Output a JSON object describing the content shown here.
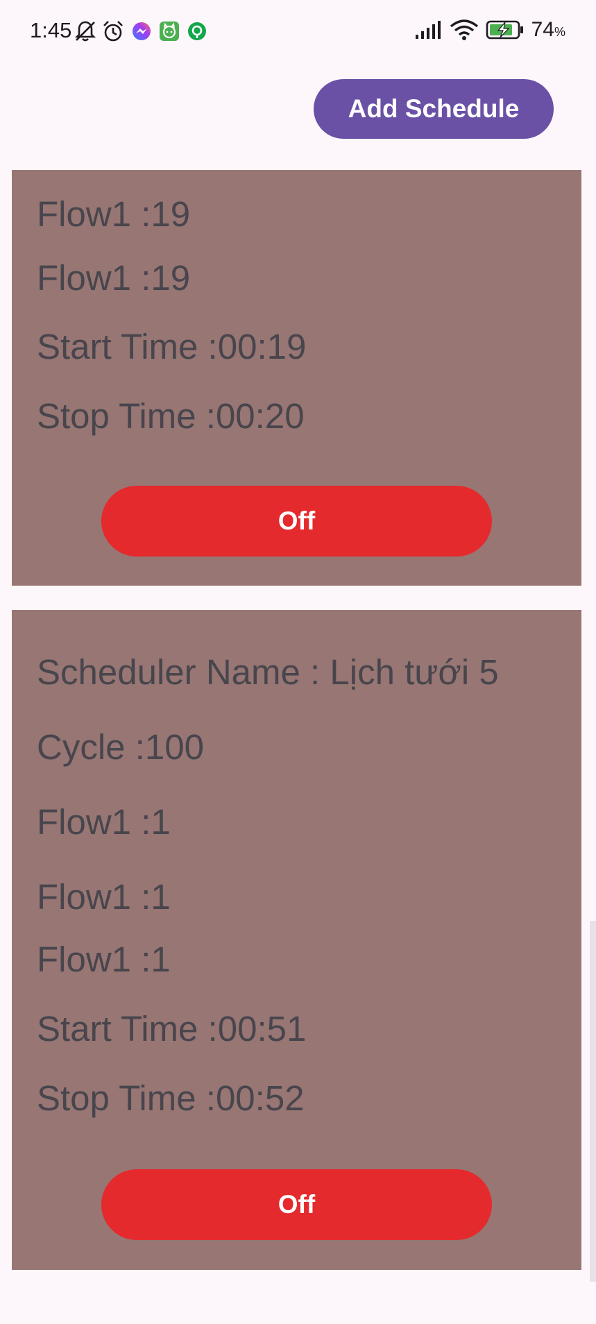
{
  "status_bar": {
    "time": "1:45",
    "battery_percent": "74",
    "battery_unit": "%"
  },
  "toolbar": {
    "add_schedule_label": "Add Schedule"
  },
  "cards": [
    {
      "fields": [
        "Flow1 :19",
        "Flow1 :19",
        "Start Time :00:19",
        "Stop Time :00:20"
      ],
      "button_label": "Off"
    },
    {
      "fields": [
        "Scheduler Name : Lịch tưới 5",
        "Cycle :100",
        "Flow1 :1",
        "Flow1 :1",
        "Flow1 :1",
        "Start Time :00:51",
        "Stop Time :00:52"
      ],
      "button_label": "Off"
    }
  ],
  "colors": {
    "accent": "#6a51a6",
    "card": "#977673",
    "off_button": "#e52a2d",
    "background": "#fdf7fc"
  }
}
